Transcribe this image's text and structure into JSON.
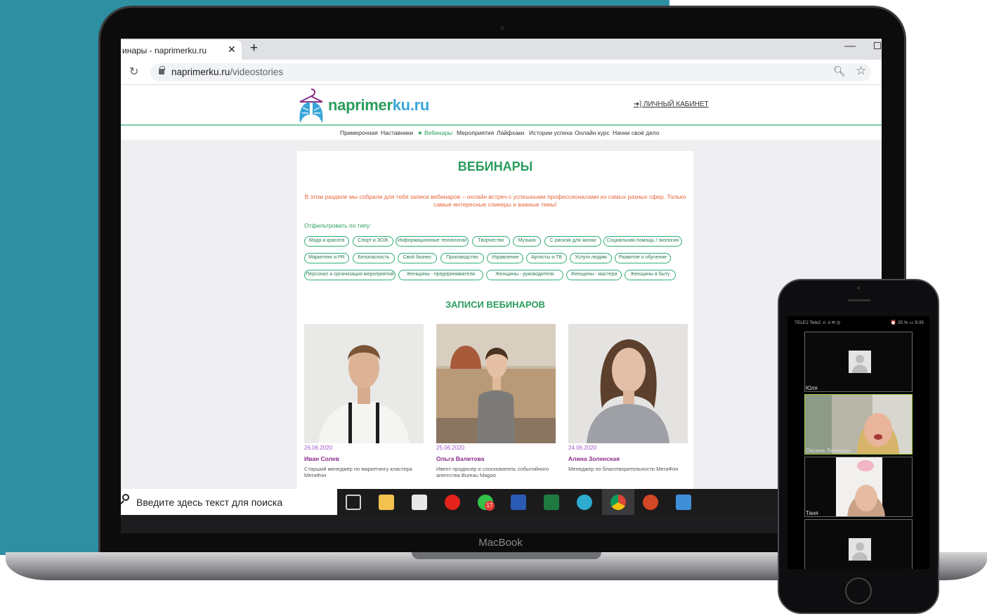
{
  "browser": {
    "tab_title": "инары - naprimerku.ru",
    "tab_close": "✕",
    "new_tab": "+",
    "url_host": "naprimerku.ru",
    "url_path": "/videostories",
    "window_minimize": "—"
  },
  "site": {
    "logo_part1": "naprimer",
    "logo_part2": "ku.ru",
    "cabinet": "➜] ЛИЧНЫЙ КАБИНЕТ",
    "nav": [
      "Примерочная",
      "Наставники",
      "★ Вебинары",
      "Мероприятия",
      "Лайфхаки",
      "Истории успеха",
      "Онлайн курс",
      "Начни своё дело"
    ],
    "nav_active": "★ Вебинары",
    "title": "ВЕБИНАРЫ",
    "intro": "В этом разделе мы собрали для тебя записи вебинаров – онлайн встреч с успешными профессионалами из самых разных сфер. Только самые интересные спикеры и важные темы!",
    "filter_label": "Отфильтровать по типу:",
    "filters_row1": [
      "Мода и красота",
      "Спорт и ЗОЖ",
      "Информационные технологии",
      "Творчество",
      "Музыка",
      "С риском для жизни",
      "Социальная помощь / экология"
    ],
    "filters_row2": [
      "Маркетинг и PR",
      "Безопасность",
      "Свой бизнес",
      "Производство",
      "Управление",
      "Артисты и ТВ",
      "Услуги людям",
      "Развитие и обучение"
    ],
    "filters_row3": [
      "Персонал и организация мероприятий",
      "Женщины - предприниматели",
      "Женщины - руководители",
      "Женщины - мастера",
      "Женщины в быту"
    ],
    "section_title": "ЗАПИСИ ВЕБИНАРОВ",
    "cards": [
      {
        "date": "26.06.2020",
        "name": "Иван Солев",
        "role": "Старший менеджер по маркетингу кластера МегаФон"
      },
      {
        "date": "25.06.2020",
        "name": "Ольга Валитова",
        "role": "Ивент продюсер и сооснователь событийного агентства Bureau Magoo"
      },
      {
        "date": "24.06.2020",
        "name": "Алина Золенская",
        "role": "Менеджер по благотворительности МегаФон"
      }
    ]
  },
  "taskbar": {
    "search_placeholder": "Введите здесь текст для поиска",
    "whatsapp_badge": "17",
    "icons": [
      "task-view-icon",
      "file-explorer-icon",
      "store-icon",
      "opera-icon",
      "whatsapp-icon",
      "word-icon",
      "excel-icon",
      "edge-icon",
      "chrome-icon",
      "powerpoint-icon",
      "photos-icon"
    ]
  },
  "laptop": {
    "brand": "MacBook"
  },
  "phone": {
    "status_left": "TELE2 Tele2 .ıl .ıl ✉ ◎",
    "status_right": "⏰ 25 % ▭ 9:35",
    "participants": [
      "Юля",
      "Оксана Лемишко",
      "Таня",
      ""
    ]
  },
  "colors": {
    "teal_background": "#2e8fa3",
    "brand_green": "#2a9d5c",
    "intro_orange": "#e8633a",
    "name_purple": "#8a2c88"
  }
}
